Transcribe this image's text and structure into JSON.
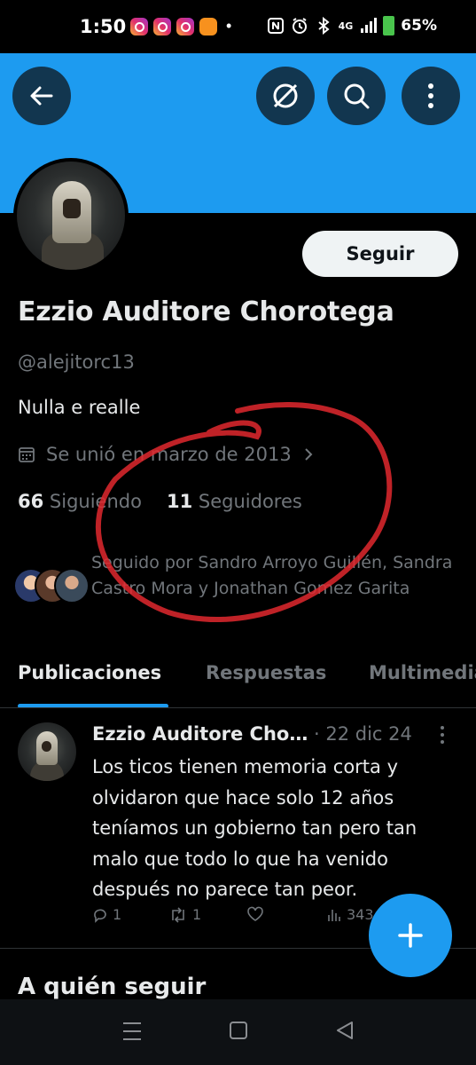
{
  "status_bar": {
    "time": "1:50",
    "network": "4G",
    "battery": "65%",
    "battery_color": "#49c44c"
  },
  "header": {
    "back_icon": "back-arrow-icon",
    "grok_icon": "grok-icon",
    "search_icon": "search-icon",
    "more_icon": "more-vertical-icon",
    "banner_color": "#1d9bf0"
  },
  "profile": {
    "follow_label": "Seguir",
    "display_name": "Ezzio Auditore Chorotega",
    "handle": "@alejitorc13",
    "bio": "Nulla e realle",
    "joined": "Se unió en marzo de 2013",
    "following_count": "66",
    "following_label": "Siguiendo",
    "followers_count": "11",
    "followers_label": "Seguidores",
    "followed_by": "Seguido por Sandro Arroyo Guillén, Sandra Castro Mora y Jonathan Gomez Garita"
  },
  "tabs": [
    {
      "label": "Publicaciones",
      "active": true
    },
    {
      "label": "Respuestas",
      "active": false
    },
    {
      "label": "Multimedia",
      "active": false
    }
  ],
  "post": {
    "author": "Ezzio Auditore Cho…",
    "date": "22 dic 24",
    "text": "Los ticos tienen memoria corta y olvidaron que hace solo 12 años teníamos un gobierno tan pero tan malo que todo lo que ha venido después no parece tan peor.",
    "replies": "1",
    "reposts": "1",
    "views": "343"
  },
  "section_who_to_follow": "A quién seguir",
  "accent_color": "#1d9bf0",
  "annotation_color": "#e0282e"
}
